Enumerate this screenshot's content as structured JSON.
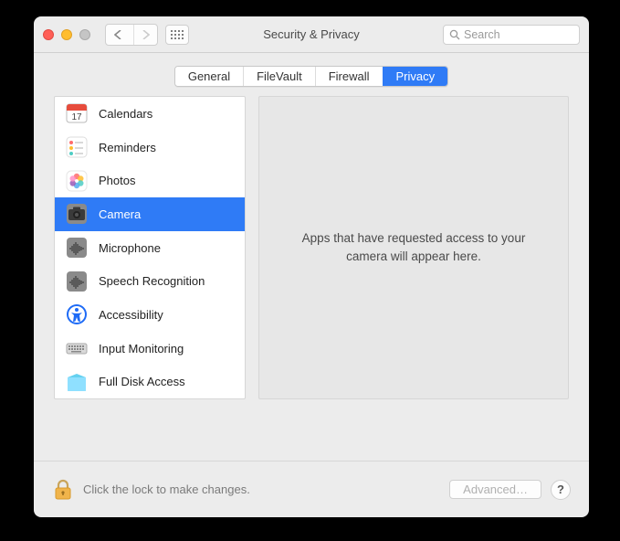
{
  "window": {
    "title": "Security & Privacy"
  },
  "search": {
    "placeholder": "Search"
  },
  "tabs": {
    "general": "General",
    "filevault": "FileVault",
    "firewall": "Firewall",
    "privacy": "Privacy",
    "active": "privacy"
  },
  "sidebar": {
    "items": [
      {
        "label": "Calendars",
        "icon": "calendar-icon"
      },
      {
        "label": "Reminders",
        "icon": "reminders-icon"
      },
      {
        "label": "Photos",
        "icon": "photos-icon"
      },
      {
        "label": "Camera",
        "icon": "camera-icon",
        "selected": true
      },
      {
        "label": "Microphone",
        "icon": "microphone-icon"
      },
      {
        "label": "Speech Recognition",
        "icon": "speech-icon"
      },
      {
        "label": "Accessibility",
        "icon": "accessibility-icon"
      },
      {
        "label": "Input Monitoring",
        "icon": "keyboard-icon"
      },
      {
        "label": "Full Disk Access",
        "icon": "disk-icon"
      }
    ]
  },
  "detail": {
    "message": "Apps that have requested access to your camera will appear here."
  },
  "footer": {
    "lock_text": "Click the lock to make changes.",
    "advanced": "Advanced…",
    "help": "?"
  }
}
